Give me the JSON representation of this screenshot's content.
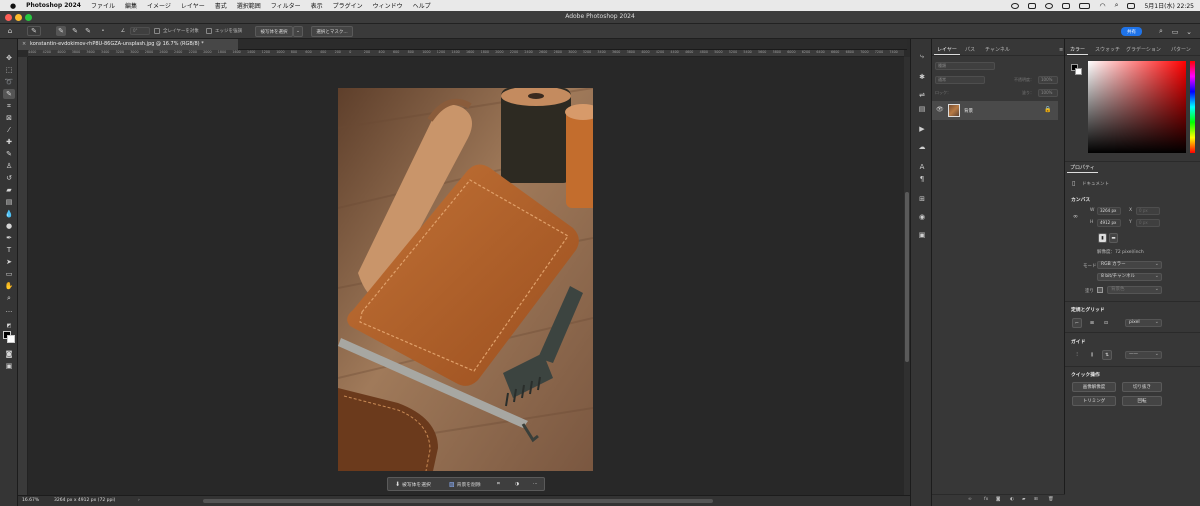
{
  "menubar": {
    "apple": "",
    "app_name": "Photoshop 2024",
    "items": [
      "ファイル",
      "編集",
      "イメージ",
      "レイヤー",
      "書式",
      "選択範囲",
      "フィルター",
      "表示",
      "プラグイン",
      "ウィンドウ",
      "ヘルプ"
    ],
    "clock": "5月1日(水) 22:25"
  },
  "window": {
    "title": "Adobe Photoshop 2024"
  },
  "options_bar": {
    "angle": "0°",
    "sample_all_layers": "全レイヤーを対象",
    "enhance_edge": "エッジを強調",
    "select_subject": "被写体を選択",
    "select_and_mask": "選択とマスク...",
    "share": "共有"
  },
  "document": {
    "tab_title": "konstantin-evdokimov-rhP8U-86GZA-unsplash.jpg @ 16.7% (RGB/8) *",
    "close": "×"
  },
  "ruler_labels": [
    "4400",
    "4200",
    "4000",
    "3800",
    "3600",
    "3400",
    "3200",
    "3000",
    "2800",
    "2600",
    "2400",
    "2200",
    "2000",
    "1800",
    "1600",
    "1400",
    "1200",
    "1000",
    "800",
    "600",
    "400",
    "200",
    "0",
    "200",
    "400",
    "600",
    "800",
    "1000",
    "1200",
    "1400",
    "1600",
    "1800",
    "2000",
    "2200",
    "2400",
    "2600",
    "2800",
    "3000",
    "3200",
    "3400",
    "3600",
    "3800",
    "4000",
    "4200",
    "4400",
    "4600",
    "4800",
    "5000",
    "5200",
    "5400",
    "5600",
    "5800",
    "6000",
    "6200",
    "6400",
    "6600",
    "6800",
    "7000",
    "7200",
    "7400",
    "7600"
  ],
  "taskbar": {
    "select_subject": "被写体を選択",
    "remove_background": "背景を削除",
    "more": "···"
  },
  "status": {
    "zoom": "16.67%",
    "doc_info": "3264 px x 4912 px (72 ppi)",
    "arrow": "›"
  },
  "layers_panel": {
    "tabs": [
      "レイヤー",
      "パス",
      "チャンネル"
    ],
    "filter_placeholder": "種類",
    "blend_mode": "通常",
    "opacity_label": "不透明度：",
    "opacity_value": "100%",
    "lock_label": "ロック：",
    "fill_label": "塗り：",
    "fill_value": "100%",
    "layer_name": "背景",
    "footer_icons": [
      "link-icon",
      "fx-icon",
      "mask-icon",
      "adjustment-icon",
      "folder-icon",
      "new-layer-icon",
      "trash-icon"
    ]
  },
  "color_panel": {
    "tabs": [
      "カラー",
      "スウォッチ",
      "グラデーション",
      "パターン"
    ],
    "foreground": "#000000",
    "background": "#ffffff"
  },
  "properties_panel": {
    "tab": "プロパティ",
    "type": "ドキュメント",
    "canvas_section": "カンバス",
    "w_label": "W",
    "w_value": "3264 px",
    "h_label": "H",
    "h_value": "4912 px",
    "x_label": "X",
    "y_label": "Y",
    "x_value": "0 px",
    "y_value": "0 px",
    "resolution": "解像度：72 pixel/inch",
    "mode_label": "モード",
    "mode_value": "RGB カラー",
    "depth_value": "8 bit/チャンネル",
    "fill_label": "塗り",
    "fill_value": "背景色",
    "rulers_section": "定規とグリッド",
    "rulers_unit": "pixel",
    "guides_section": "ガイド",
    "quick_actions_section": "クイック操作",
    "qa_buttons": [
      "画像解像度",
      "切り抜き",
      "トリミング",
      "回転"
    ]
  },
  "colors": {
    "accent": "#1f73e8",
    "panel_bg": "#373737",
    "canvas_bg": "#282828"
  }
}
